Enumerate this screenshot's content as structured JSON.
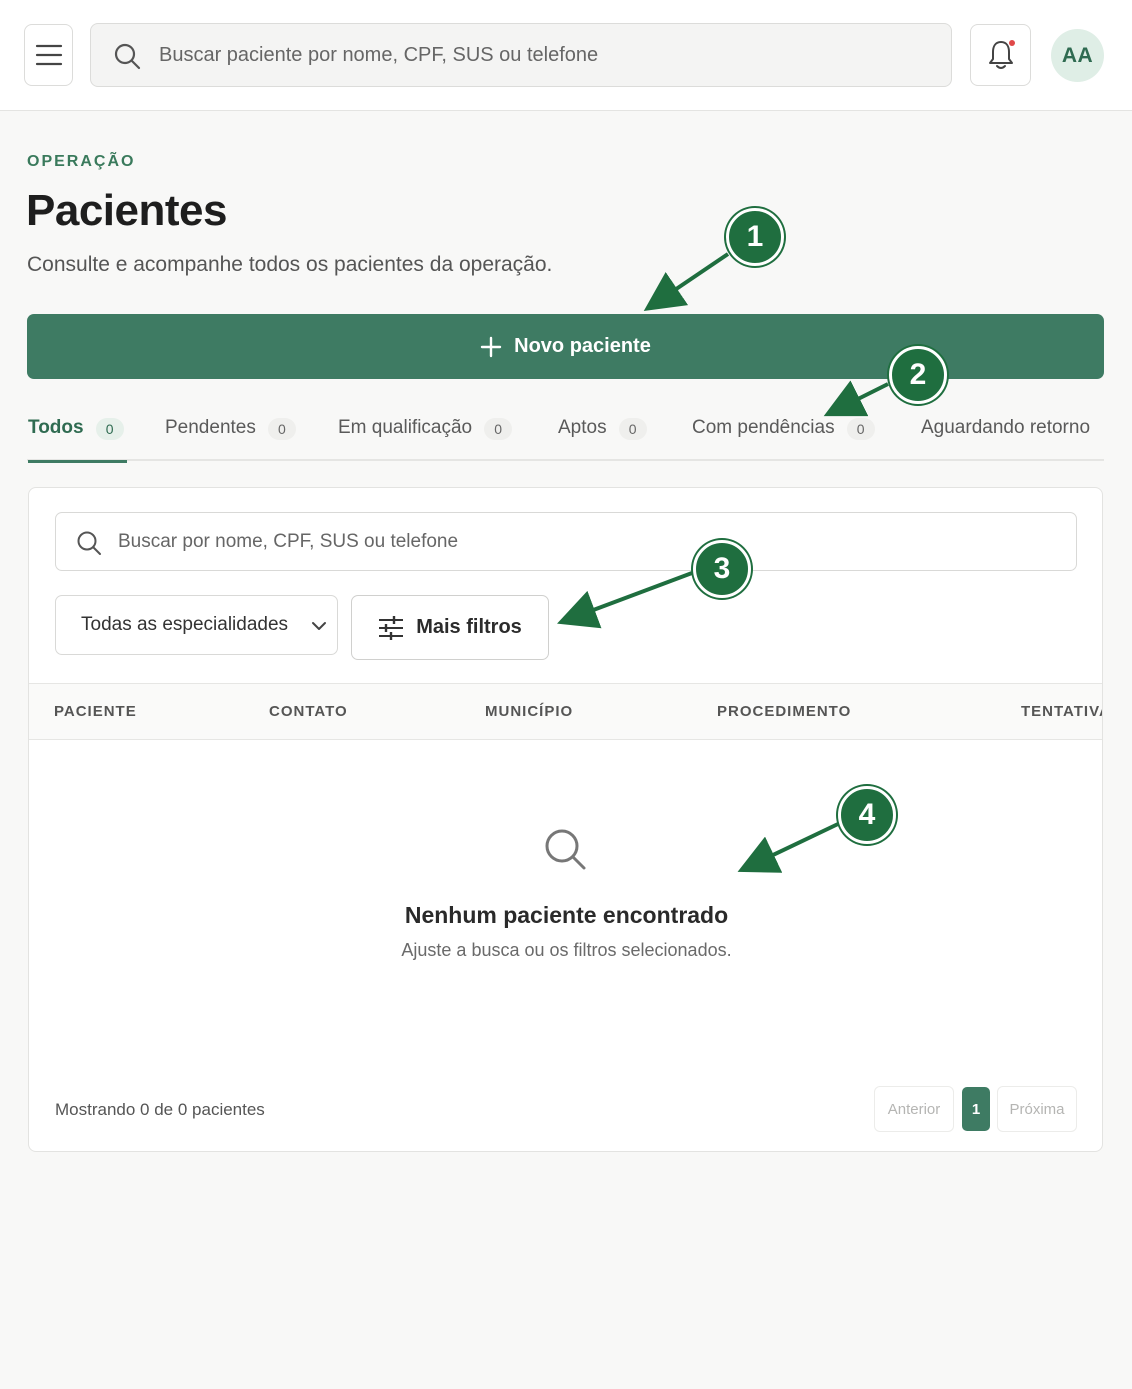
{
  "topbar": {
    "search_placeholder": "Buscar paciente por nome, CPF, SUS ou telefone",
    "avatar_initials": "AA"
  },
  "header": {
    "eyebrow": "OPERAÇÃO",
    "title": "Pacientes",
    "subtitle": "Consulte e acompanhe todos os pacientes da operação."
  },
  "new_button": {
    "label": "Novo paciente",
    "icon": "plus-icon"
  },
  "tabs": [
    {
      "label": "Todos",
      "count": "0",
      "active": true
    },
    {
      "label": "Pendentes",
      "count": "0"
    },
    {
      "label": "Em qualificação",
      "count": "0"
    },
    {
      "label": "Aptos",
      "count": "0"
    },
    {
      "label": "Com pendências",
      "count": "0"
    },
    {
      "label": "Aguardando retorno"
    }
  ],
  "filters": {
    "search_placeholder": "Buscar por nome, CPF, SUS ou telefone",
    "specialty_selected": "Todas as especialidades",
    "more_filters_label": "Mais filtros"
  },
  "table": {
    "columns": [
      "PACIENTE",
      "CONTATO",
      "MUNICÍPIO",
      "PROCEDIMENTO",
      "TENTATIVA"
    ]
  },
  "empty_state": {
    "icon": "search-icon",
    "title": "Nenhum paciente encontrado",
    "subtitle": "Ajuste a busca ou os filtros selecionados."
  },
  "footer": {
    "showing": "Mostrando 0 de 0 pacientes",
    "prev_label": "Anterior",
    "current_page": "1",
    "next_label": "Próxima"
  },
  "callouts": [
    "1",
    "2",
    "3",
    "4"
  ],
  "colors": {
    "primary": "#3e7b63",
    "callout": "#1f6e3f",
    "eyebrow": "#3a7a5c",
    "notification_dot": "#e04848"
  }
}
